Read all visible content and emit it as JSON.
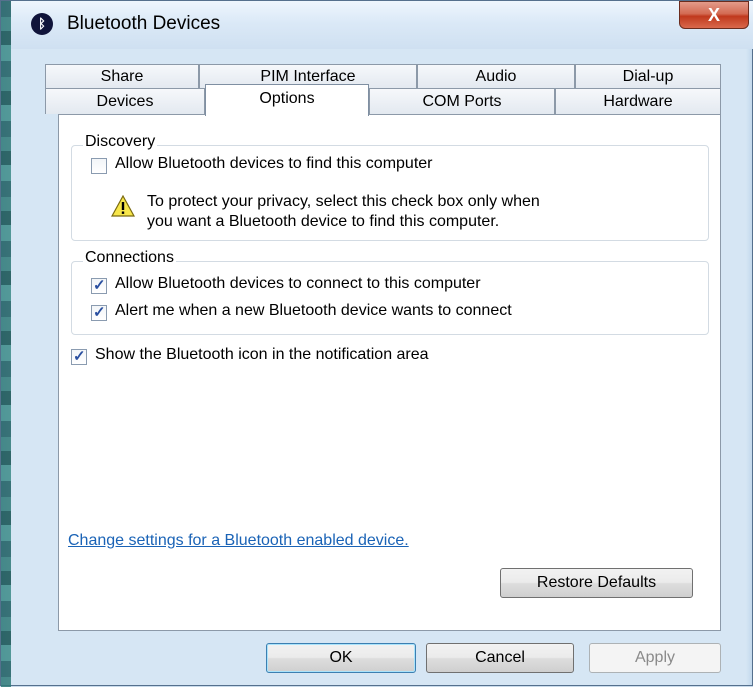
{
  "window": {
    "title": "Bluetooth Devices",
    "icon": "bluetooth-icon",
    "close_glyph": "X"
  },
  "tabs": {
    "row1": [
      "Share",
      "PIM Interface",
      "Audio",
      "Dial-up"
    ],
    "row2": [
      "Devices",
      "Options",
      "COM Ports",
      "Hardware"
    ],
    "active": "Options"
  },
  "discovery": {
    "legend": "Discovery",
    "allow_find": {
      "label": "Allow Bluetooth devices to find this computer",
      "checked": false
    },
    "warning_line1": "To protect your privacy, select this check box only when",
    "warning_line2": "you want a Bluetooth device to find this computer.",
    "warning_icon": "warning-icon"
  },
  "connections": {
    "legend": "Connections",
    "allow_connect": {
      "label": "Allow Bluetooth devices to connect to this computer",
      "checked": true
    },
    "alert_new": {
      "label": "Alert me when a new Bluetooth device wants to connect",
      "checked": true
    }
  },
  "show_icon": {
    "label": "Show the Bluetooth icon in the notification area",
    "checked": true
  },
  "settings_link": "Change settings for a Bluetooth enabled device.",
  "restore_defaults": "Restore Defaults",
  "buttons": {
    "ok": "OK",
    "cancel": "Cancel",
    "apply": "Apply"
  }
}
